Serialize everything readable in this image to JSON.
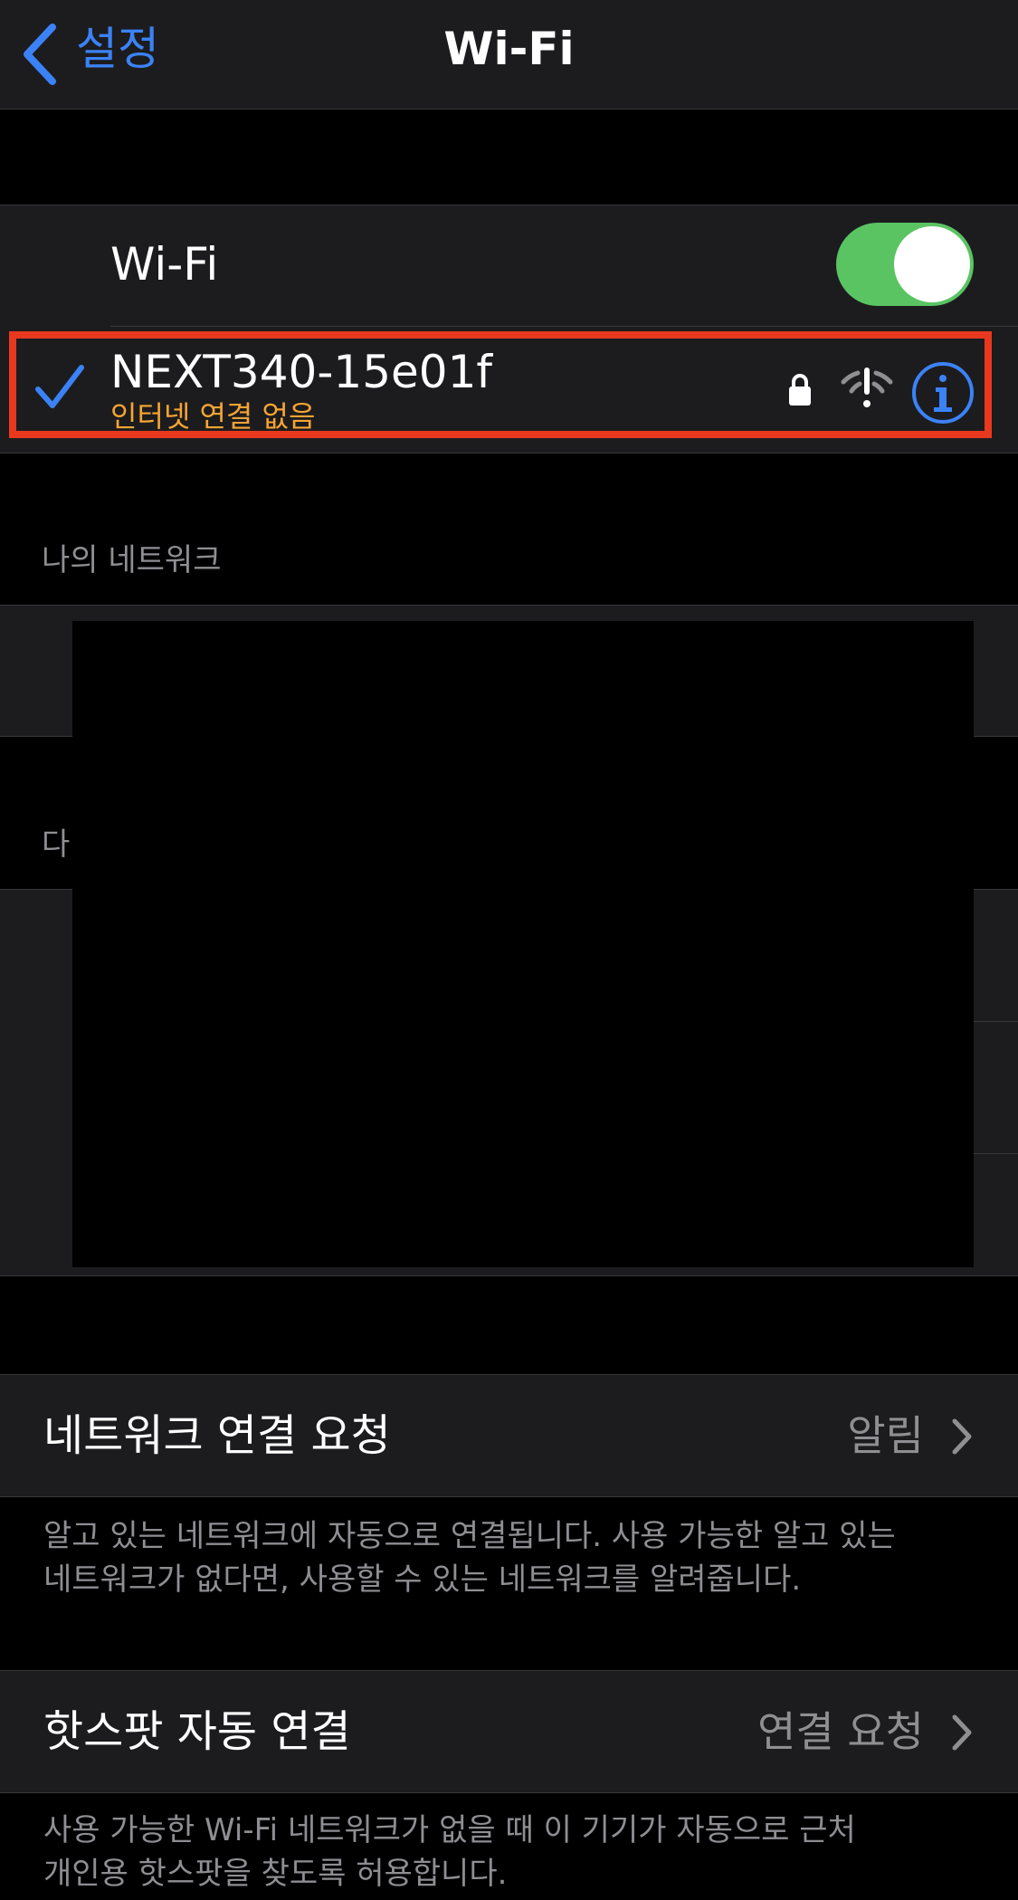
{
  "nav": {
    "back_label": "설정",
    "title": "Wi-Fi"
  },
  "wifi_toggle": {
    "label": "Wi-Fi",
    "on": true,
    "on_color": "#5ac463"
  },
  "connected_network": {
    "ssid": "NEXT340-15e01f",
    "status": "인터넷 연결 없음",
    "status_color": "#f6a433",
    "icons": [
      "checkmark-icon",
      "lock-icon",
      "wifi-warning-icon",
      "info-icon"
    ]
  },
  "sections": {
    "my_networks": "나의 네트워크",
    "other_networks": "다"
  },
  "ask_to_join": {
    "label": "네트워크 연결 요청",
    "value": "알림",
    "footer_line1": "알고 있는 네트워크에 자동으로 연결됩니다. 사용 가능한 알고 있는",
    "footer_line2": "네트워크가 없다면, 사용할 수 있는 네트워크를 알려줍니다."
  },
  "auto_join_hotspot": {
    "label": "핫스팟 자동 연결",
    "value": "연결 요청",
    "footer_line1": "사용 가능한 Wi-Fi 네트워크가 없을 때 이 기기가 자동으로 근처",
    "footer_line2": "개인용 핫스팟을 찾도록 허용합니다."
  },
  "colors": {
    "accent": "#3b82f6",
    "highlight_border": "#e8391f",
    "cell_bg": "#1c1c1e"
  }
}
